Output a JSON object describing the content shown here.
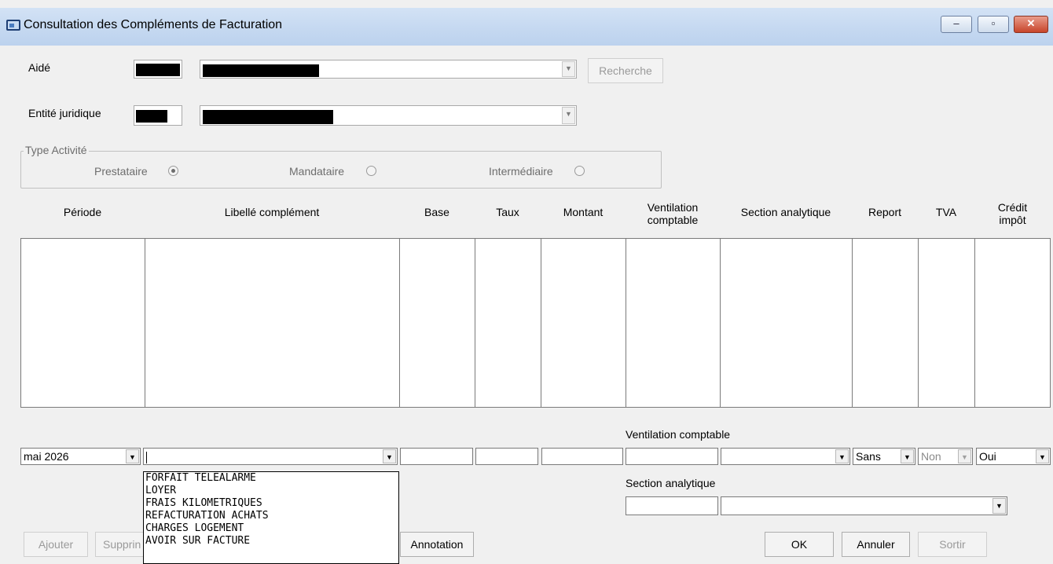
{
  "window": {
    "title": "Consultation des Compléments de Facturation",
    "minimize_glyph": "‒",
    "maximize_glyph": "▫",
    "close_glyph": "✕"
  },
  "aide": {
    "label": "Aidé",
    "search_label": "Recherche"
  },
  "entite": {
    "label": "Entité juridique"
  },
  "type_activite": {
    "legend": "Type Activité",
    "options": [
      {
        "label": "Prestataire",
        "selected": true
      },
      {
        "label": "Mandataire",
        "selected": false
      },
      {
        "label": "Intermédiaire",
        "selected": false
      }
    ]
  },
  "grid": {
    "columns": [
      {
        "line1": "Période",
        "line2": ""
      },
      {
        "line1": "Libellé complément",
        "line2": ""
      },
      {
        "line1": "Base",
        "line2": ""
      },
      {
        "line1": "Taux",
        "line2": ""
      },
      {
        "line1": "Montant",
        "line2": ""
      },
      {
        "line1": "Ventilation",
        "line2": "comptable"
      },
      {
        "line1": "Section analytique",
        "line2": ""
      },
      {
        "line1": "Report",
        "line2": ""
      },
      {
        "line1": "TVA",
        "line2": ""
      },
      {
        "line1": "Crédit",
        "line2": "impôt"
      }
    ]
  },
  "edit_row": {
    "periode_value": "mai 2026",
    "libelle_value": "",
    "ventilation_label": "Ventilation comptable",
    "report_value": "Sans",
    "tva_value": "Non",
    "credit_value": "Oui",
    "section_label": "Section analytique"
  },
  "libelle_options": [
    "FORFAIT TELEALARME",
    "LOYER",
    "FRAIS KILOMETRIQUES",
    "REFACTURATION ACHATS",
    "CHARGES LOGEMENT",
    "AVOIR SUR FACTURE"
  ],
  "buttons": {
    "ajouter": "Ajouter",
    "supprimer": "Supprin",
    "annotation": "Annotation",
    "ok": "OK",
    "annuler": "Annuler",
    "sortir": "Sortir"
  },
  "dropdown_arrow": "▼"
}
